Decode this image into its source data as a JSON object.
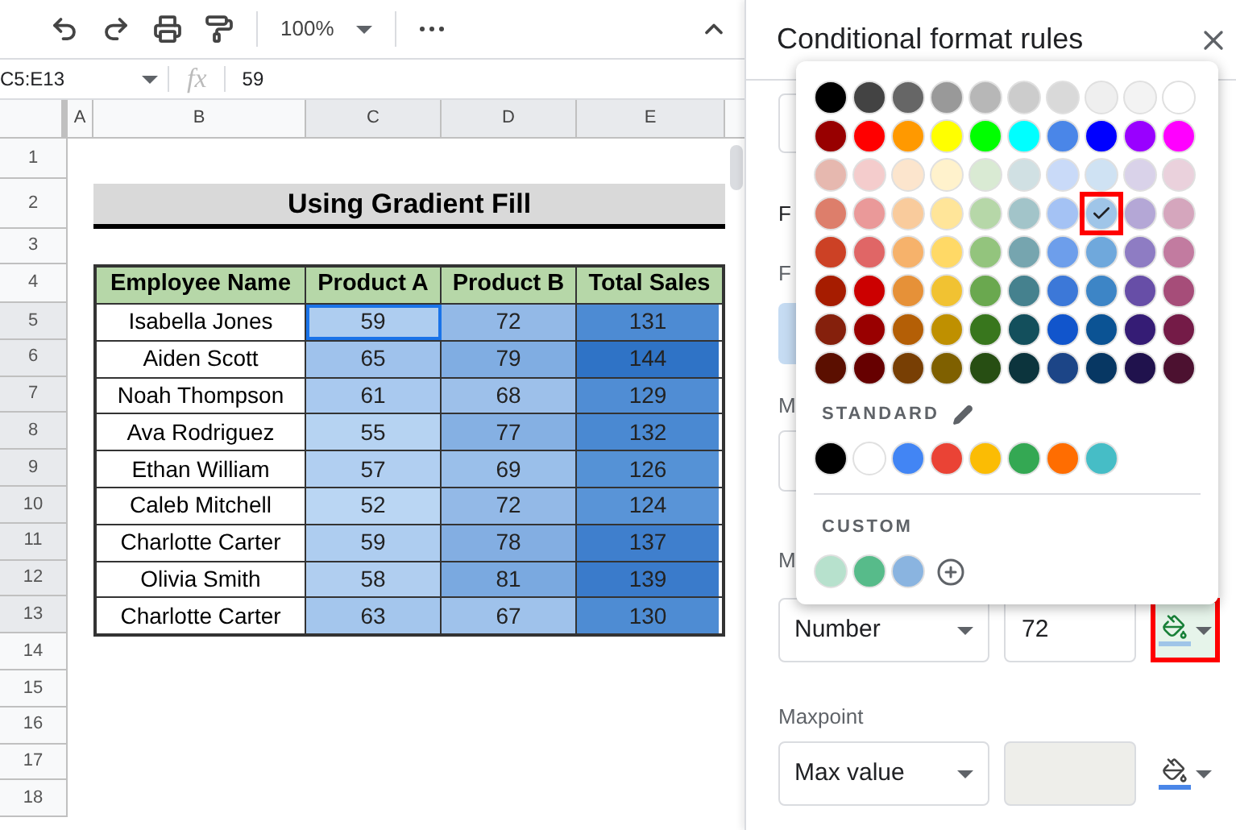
{
  "toolbar": {
    "zoom": "100%"
  },
  "formula_bar": {
    "name_box": "C5:E13",
    "fx": "fx",
    "value": "59"
  },
  "columns": [
    "A",
    "B",
    "C",
    "D",
    "E"
  ],
  "row_numbers": [
    "1",
    "2",
    "3",
    "4",
    "5",
    "6",
    "7",
    "8",
    "9",
    "10",
    "11",
    "12",
    "13",
    "14",
    "15",
    "16",
    "17",
    "18"
  ],
  "sheet": {
    "title": "Using Gradient Fill",
    "headers": [
      "Employee Name",
      "Product A",
      "Product B",
      "Total Sales"
    ],
    "rows": [
      {
        "name": "Isabella Jones",
        "cells": [
          {
            "text": "59",
            "color": "#aecdf0",
            "selected": true
          },
          {
            "text": "72",
            "color": "#93b9e7",
            "selected": false
          },
          {
            "text": "131",
            "color": "#4d8bd3",
            "selected": false
          }
        ]
      },
      {
        "name": "Aiden Scott",
        "cells": [
          {
            "text": "65",
            "color": "#9fc2ec",
            "selected": false
          },
          {
            "text": "79",
            "color": "#80ade2",
            "selected": false
          },
          {
            "text": "144",
            "color": "#2f73c6",
            "selected": false
          }
        ]
      },
      {
        "name": "Noah Thompson",
        "cells": [
          {
            "text": "61",
            "color": "#a9c9ef",
            "selected": false
          },
          {
            "text": "68",
            "color": "#9dc0ea",
            "selected": false
          },
          {
            "text": "129",
            "color": "#508dd4",
            "selected": false
          }
        ]
      },
      {
        "name": "Ava Rodriguez",
        "cells": [
          {
            "text": "55",
            "color": "#b6d3f2",
            "selected": false
          },
          {
            "text": "77",
            "color": "#85b0e3",
            "selected": false
          },
          {
            "text": "132",
            "color": "#4a89d2",
            "selected": false
          }
        ]
      },
      {
        "name": "Ethan William",
        "cells": [
          {
            "text": "57",
            "color": "#b1cff1",
            "selected": false
          },
          {
            "text": "69",
            "color": "#9abfea",
            "selected": false
          },
          {
            "text": "126",
            "color": "#5592d6",
            "selected": false
          }
        ]
      },
      {
        "name": "Caleb Mitchell",
        "cells": [
          {
            "text": "52",
            "color": "#bad6f3",
            "selected": false
          },
          {
            "text": "72",
            "color": "#93b9e7",
            "selected": false
          },
          {
            "text": "124",
            "color": "#5994d7",
            "selected": false
          }
        ]
      },
      {
        "name": "Charlotte Carter",
        "cells": [
          {
            "text": "59",
            "color": "#aecdf0",
            "selected": false
          },
          {
            "text": "78",
            "color": "#83aee2",
            "selected": false
          },
          {
            "text": "137",
            "color": "#3f7fcd",
            "selected": false
          }
        ]
      },
      {
        "name": "Olivia Smith",
        "cells": [
          {
            "text": "58",
            "color": "#b0cef0",
            "selected": false
          },
          {
            "text": "81",
            "color": "#7aa9e0",
            "selected": false
          },
          {
            "text": "139",
            "color": "#3a7bcb",
            "selected": false
          }
        ]
      },
      {
        "name": "Charlotte Carter",
        "cells": [
          {
            "text": "63",
            "color": "#a4c6ed",
            "selected": false
          },
          {
            "text": "67",
            "color": "#9fc2eb",
            "selected": false
          },
          {
            "text": "130",
            "color": "#4e8cd3",
            "selected": false
          }
        ]
      }
    ]
  },
  "panel": {
    "title": "Conditional format rules",
    "labels": [
      "F",
      "F",
      "M",
      "M"
    ],
    "midpoint": {
      "type": "Number",
      "value": "72",
      "color": "#9fc5e8",
      "highlighted": true
    },
    "maxpoint": {
      "label": "Maxpoint",
      "type": "Max value",
      "color": "#4a86e8",
      "highlighted": false
    }
  },
  "palette": {
    "swatches": [
      [
        {
          "color": "#000000",
          "selected": false
        },
        {
          "color": "#434343",
          "selected": false
        },
        {
          "color": "#666666",
          "selected": false
        },
        {
          "color": "#999999",
          "selected": false
        },
        {
          "color": "#b7b7b7",
          "selected": false
        },
        {
          "color": "#cccccc",
          "selected": false
        },
        {
          "color": "#d9d9d9",
          "selected": false
        },
        {
          "color": "#efefef",
          "selected": false
        },
        {
          "color": "#f3f3f3",
          "selected": false
        },
        {
          "color": "#ffffff",
          "selected": false
        }
      ],
      [
        {
          "color": "#980000",
          "selected": false
        },
        {
          "color": "#ff0000",
          "selected": false
        },
        {
          "color": "#ff9900",
          "selected": false
        },
        {
          "color": "#ffff00",
          "selected": false
        },
        {
          "color": "#00ff00",
          "selected": false
        },
        {
          "color": "#00ffff",
          "selected": false
        },
        {
          "color": "#4a86e8",
          "selected": false
        },
        {
          "color": "#0000ff",
          "selected": false
        },
        {
          "color": "#9900ff",
          "selected": false
        },
        {
          "color": "#ff00ff",
          "selected": false
        }
      ],
      [
        {
          "color": "#e6b8af",
          "selected": false
        },
        {
          "color": "#f4cccc",
          "selected": false
        },
        {
          "color": "#fce5cd",
          "selected": false
        },
        {
          "color": "#fff2cc",
          "selected": false
        },
        {
          "color": "#d9ead3",
          "selected": false
        },
        {
          "color": "#d0e0e3",
          "selected": false
        },
        {
          "color": "#c9daf8",
          "selected": false
        },
        {
          "color": "#cfe2f3",
          "selected": false
        },
        {
          "color": "#d9d2e9",
          "selected": false
        },
        {
          "color": "#ead1dc",
          "selected": false
        }
      ],
      [
        {
          "color": "#dd7e6b",
          "selected": false
        },
        {
          "color": "#ea9999",
          "selected": false
        },
        {
          "color": "#f9cb9c",
          "selected": false
        },
        {
          "color": "#ffe599",
          "selected": false
        },
        {
          "color": "#b6d7a8",
          "selected": false
        },
        {
          "color": "#a2c4c9",
          "selected": false
        },
        {
          "color": "#a4c2f4",
          "selected": false
        },
        {
          "color": "#9fc5e8",
          "selected": true
        },
        {
          "color": "#b4a7d6",
          "selected": false
        },
        {
          "color": "#d5a6bd",
          "selected": false
        }
      ],
      [
        {
          "color": "#cc4125",
          "selected": false
        },
        {
          "color": "#e06666",
          "selected": false
        },
        {
          "color": "#f6b26b",
          "selected": false
        },
        {
          "color": "#ffd966",
          "selected": false
        },
        {
          "color": "#93c47d",
          "selected": false
        },
        {
          "color": "#76a5af",
          "selected": false
        },
        {
          "color": "#6d9eeb",
          "selected": false
        },
        {
          "color": "#6fa8dc",
          "selected": false
        },
        {
          "color": "#8e7cc3",
          "selected": false
        },
        {
          "color": "#c27ba0",
          "selected": false
        }
      ],
      [
        {
          "color": "#a61c00",
          "selected": false
        },
        {
          "color": "#cc0000",
          "selected": false
        },
        {
          "color": "#e69138",
          "selected": false
        },
        {
          "color": "#f1c232",
          "selected": false
        },
        {
          "color": "#6aa84f",
          "selected": false
        },
        {
          "color": "#45818e",
          "selected": false
        },
        {
          "color": "#3c78d8",
          "selected": false
        },
        {
          "color": "#3d85c6",
          "selected": false
        },
        {
          "color": "#674ea7",
          "selected": false
        },
        {
          "color": "#a64d79",
          "selected": false
        }
      ],
      [
        {
          "color": "#85200c",
          "selected": false
        },
        {
          "color": "#990000",
          "selected": false
        },
        {
          "color": "#b45f06",
          "selected": false
        },
        {
          "color": "#bf9000",
          "selected": false
        },
        {
          "color": "#38761d",
          "selected": false
        },
        {
          "color": "#134f5c",
          "selected": false
        },
        {
          "color": "#1155cc",
          "selected": false
        },
        {
          "color": "#0b5394",
          "selected": false
        },
        {
          "color": "#351c75",
          "selected": false
        },
        {
          "color": "#741b47",
          "selected": false
        }
      ],
      [
        {
          "color": "#5b0f00",
          "selected": false
        },
        {
          "color": "#660000",
          "selected": false
        },
        {
          "color": "#783f04",
          "selected": false
        },
        {
          "color": "#7f6000",
          "selected": false
        },
        {
          "color": "#274e13",
          "selected": false
        },
        {
          "color": "#0c343d",
          "selected": false
        },
        {
          "color": "#1c4587",
          "selected": false
        },
        {
          "color": "#073763",
          "selected": false
        },
        {
          "color": "#20124d",
          "selected": false
        },
        {
          "color": "#4c1130",
          "selected": false
        }
      ]
    ],
    "standard_label": "STANDARD",
    "standard": [
      {
        "color": "#000000"
      },
      {
        "color": "#ffffff"
      },
      {
        "color": "#4285f4"
      },
      {
        "color": "#ea4335"
      },
      {
        "color": "#fbbc04"
      },
      {
        "color": "#34a853"
      },
      {
        "color": "#ff6d01"
      },
      {
        "color": "#46bdc6"
      }
    ],
    "custom_label": "CUSTOM",
    "custom": [
      {
        "color": "#b7e1cd"
      },
      {
        "color": "#57bb8a"
      },
      {
        "color": "#8ab4e0"
      }
    ]
  }
}
